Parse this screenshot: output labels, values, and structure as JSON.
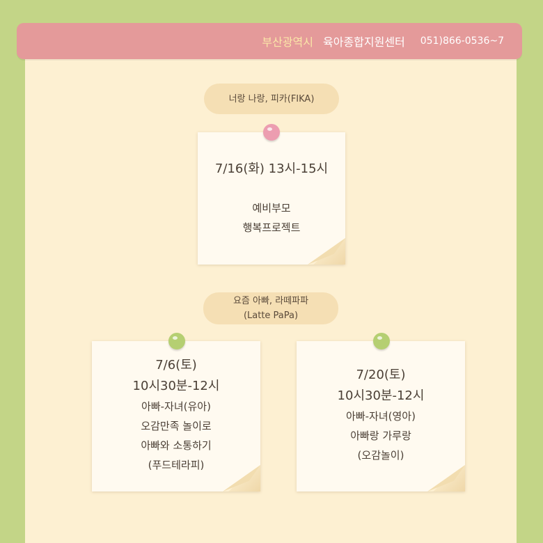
{
  "header": {
    "city": "부산광역시",
    "center": "육아종합지원센터",
    "phone": "051)866-0536~7"
  },
  "program1": {
    "title": "너랑 나랑, 피카(FIKA)",
    "date_time": "7/16(화) 13시-15시",
    "lines": [
      "예비부모",
      "행복프로젝트"
    ]
  },
  "program2": {
    "title_ko": "요즘 아빠, 라떼파파",
    "title_en": "(Latte PaPa)"
  },
  "session1": {
    "date": "7/6(토)",
    "time": "10시30분-12시",
    "lines": [
      "아빠-자녀(유아)",
      "오감만족 놀이로",
      "아빠와 소통하기",
      "(푸드테라피)"
    ]
  },
  "session2": {
    "date": "7/20(토)",
    "time": "10시30분-12시",
    "lines": [
      "아빠-자녀(영아)",
      "아빠랑 가루랑",
      "(오감놀이)"
    ]
  },
  "colors": {
    "background": "#c3d587",
    "header": "#e49a9a",
    "paper": "#fdf0d2",
    "pill": "#f5dfb4",
    "pin_pink": "#ec9db0",
    "pin_green": "#b5cf72"
  }
}
